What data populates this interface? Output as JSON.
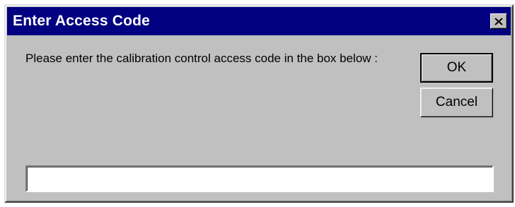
{
  "window": {
    "title": "Enter Access Code",
    "close_icon": "close-x-icon"
  },
  "message": "Please enter the calibration control access code in the box below :",
  "buttons": {
    "ok_label": "OK",
    "cancel_label": "Cancel"
  },
  "input": {
    "value": "",
    "placeholder": ""
  }
}
